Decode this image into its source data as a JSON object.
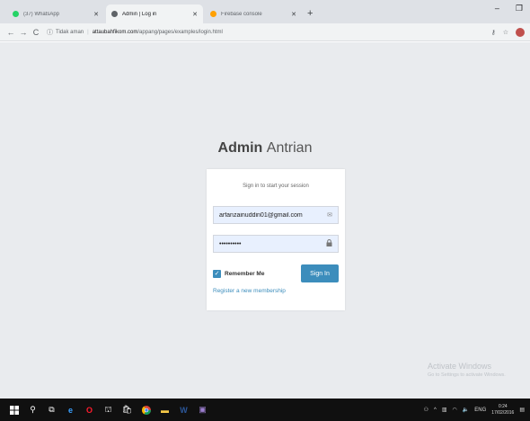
{
  "tabs": [
    {
      "label": "(37) WhatsApp",
      "favicon_color": "#25d366",
      "active": false
    },
    {
      "label": "Admin | Log in",
      "favicon_color": "#5f6368",
      "active": true
    },
    {
      "label": "Firebase console",
      "favicon_color": "#ffa000",
      "active": false
    }
  ],
  "address": {
    "security": "Tidak aman",
    "host": "attaubahfikom.com",
    "path": "/appang/pages/examples/login.html"
  },
  "brand": {
    "bold": "Admin",
    "light": "Antrian"
  },
  "login": {
    "message": "Sign in to start your session",
    "email_value": "arfanzainuddin01@gmail.com",
    "password_value": "••••••••••",
    "remember_label": "Remember Me",
    "remember_checked": true,
    "signin_label": "Sign In",
    "register_label": "Register a new membership"
  },
  "watermark": {
    "title": "Activate Windows",
    "subtitle": "Go to Settings to activate Windows."
  },
  "tray": {
    "lang": "ENG",
    "time": "0:24",
    "date": "17/02/2016"
  },
  "colors": {
    "primary": "#3c8dbc",
    "page_bg": "#e9ebee",
    "taskbar_bg": "#101010"
  },
  "icons": {
    "email_field": "envelope-icon",
    "password_field": "lock-icon"
  }
}
